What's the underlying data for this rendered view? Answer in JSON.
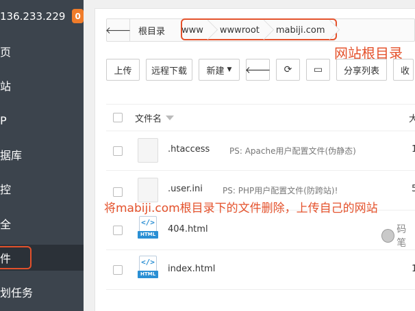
{
  "sidebar": {
    "ip": "136.233.229",
    "badge": "0",
    "items": [
      {
        "label": "页"
      },
      {
        "label": "站"
      },
      {
        "label": "P"
      },
      {
        "label": "据库"
      },
      {
        "label": "控"
      },
      {
        "label": "全"
      },
      {
        "label": "件"
      },
      {
        "label": "划任务"
      }
    ]
  },
  "pathbar": {
    "back": "🡐",
    "crumbs": [
      "根目录",
      "www",
      "wwwroot",
      "mabiji.com"
    ]
  },
  "annotations": {
    "root_dir": "网站根目录",
    "delete_hint": "将mabiji.com根目录下的文件删除，上传自己的网站",
    "watermark": "码笔"
  },
  "toolbar": {
    "upload": "上传",
    "remote_download": "远程下载",
    "new": "新建",
    "back_icon": "🡐",
    "refresh_icon": "⟳",
    "terminal_icon": "▭",
    "share_list": "分享列表",
    "favorites": "收"
  },
  "table": {
    "col_name": "文件名",
    "col_size": "大",
    "rows": [
      {
        "name": ".htaccess",
        "note": "PS: Apache用户配置文件(伪静态)",
        "size": "1",
        "icon": "file-icon"
      },
      {
        "name": ".user.ini",
        "note": "PS: PHP用户配置文件(防跨站)!",
        "size": "5",
        "icon": "file-icon"
      },
      {
        "name": "404.html",
        "note": "",
        "size": "",
        "icon": "html-icon",
        "icon_code": "</>",
        "icon_tag": "HTML"
      },
      {
        "name": "index.html",
        "note": "",
        "size": "1",
        "icon": "html-icon",
        "icon_code": "</>",
        "icon_tag": "HTML"
      }
    ]
  },
  "colors": {
    "sidebar_bg": "#3c444d",
    "badge": "#f07c2a",
    "annotation": "#e4512b",
    "html_icon": "#2a8fd4"
  }
}
